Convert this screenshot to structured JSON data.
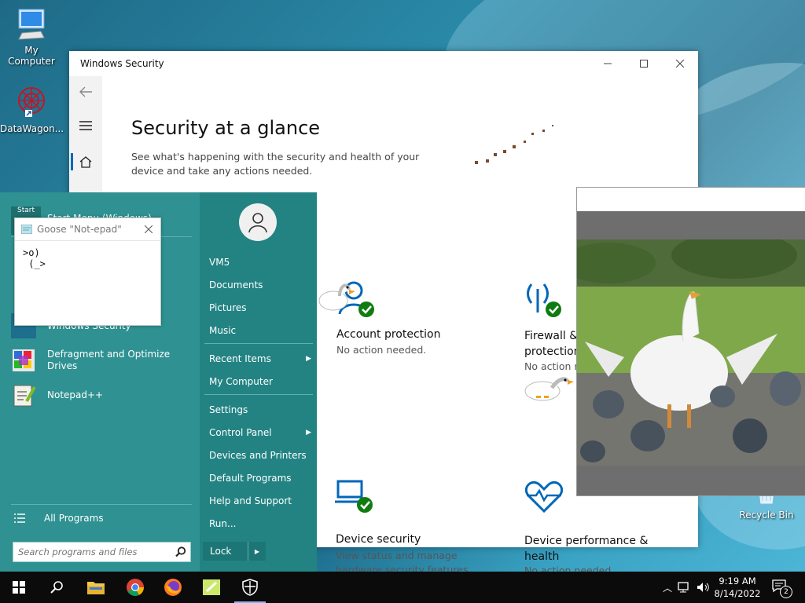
{
  "desktop": {
    "icons": [
      {
        "label": "My Computer"
      },
      {
        "label": "DataWagon..."
      },
      {
        "label": "Recycle Bin"
      }
    ]
  },
  "security_window": {
    "title": "Windows Security",
    "heading": "Security at a glance",
    "description": "See what's happening with the security and health of your device and take any actions needed.",
    "tiles": [
      {
        "name": "Account protection",
        "status": "No action needed."
      },
      {
        "name": "Firewall & network protection",
        "name_lines": [
          "Firewall &",
          "protection"
        ],
        "status": "No action n"
      },
      {
        "name": "Device security",
        "status": "View status and manage hardware security features",
        "status_lines": [
          "View status and manage",
          "hardware security features"
        ]
      },
      {
        "name": "Device performance & health",
        "name_lines": [
          "Device performance &",
          "health"
        ],
        "status": "No action needed."
      }
    ]
  },
  "start_menu": {
    "header_label": "Start",
    "header_text": "Start Menu (Windows)",
    "programs": [
      {
        "label": "Windows Security"
      },
      {
        "label": "Defragment and Optimize Drives",
        "lines": [
          "Defragment and Optimize",
          "Drives"
        ]
      },
      {
        "label": "Notepad++"
      }
    ],
    "all_programs": "All Programs",
    "search_placeholder": "Search programs and files",
    "right_items": [
      {
        "label": "VM5"
      },
      {
        "label": "Documents"
      },
      {
        "label": "Pictures"
      },
      {
        "label": "Music"
      },
      {
        "label": "Recent Items"
      },
      {
        "label": "My Computer"
      },
      {
        "label": "Settings"
      },
      {
        "label": "Control Panel"
      },
      {
        "label": "Devices and Printers"
      },
      {
        "label": "Default Programs"
      },
      {
        "label": "Help and Support"
      },
      {
        "label": "Run..."
      }
    ],
    "lock_label": "Lock"
  },
  "goose_notepad": {
    "title": "Goose \"Not-epad\"",
    "content": ">o)\n (_>"
  },
  "taskbar": {
    "time": "9:19 AM",
    "date": "8/14/2022",
    "notification_count": "2"
  },
  "colors": {
    "accent_blue": "#0067b8",
    "check_green": "#107c10",
    "start_teal": "#2f9191"
  }
}
